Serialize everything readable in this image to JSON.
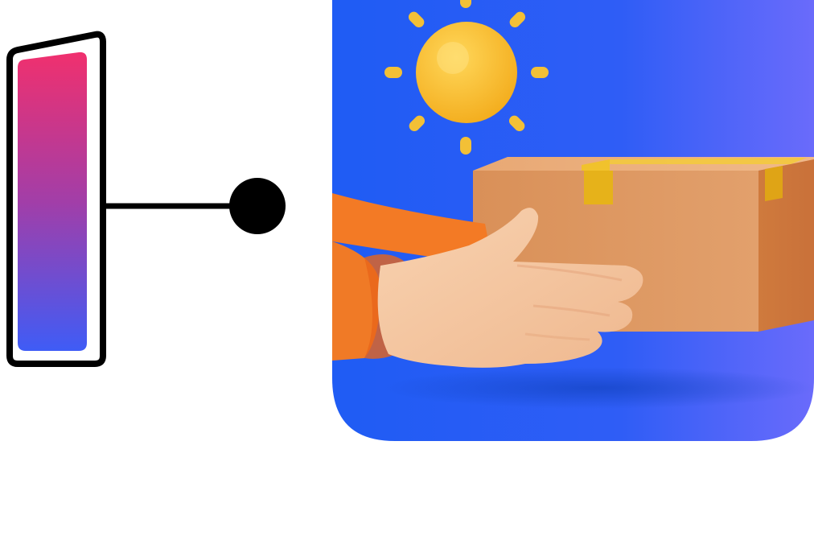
{
  "illustration": {
    "phone": {
      "icon": "phone-icon",
      "gradient_top": "#f0306e",
      "gradient_bottom": "#3f5cf6",
      "outline": "#000000"
    },
    "connector": {
      "icon": "connector-dot-icon",
      "color": "#000000"
    },
    "app_icon": {
      "icon": "delivery-app-icon",
      "background_left": "#1f5cf4",
      "background_right": "#6a6bfb",
      "sun": "#f7be2c",
      "box": "#d88f55",
      "tape": "#e6b21a",
      "hand": "#f6c59d",
      "sleeve": "#f37a25"
    }
  }
}
